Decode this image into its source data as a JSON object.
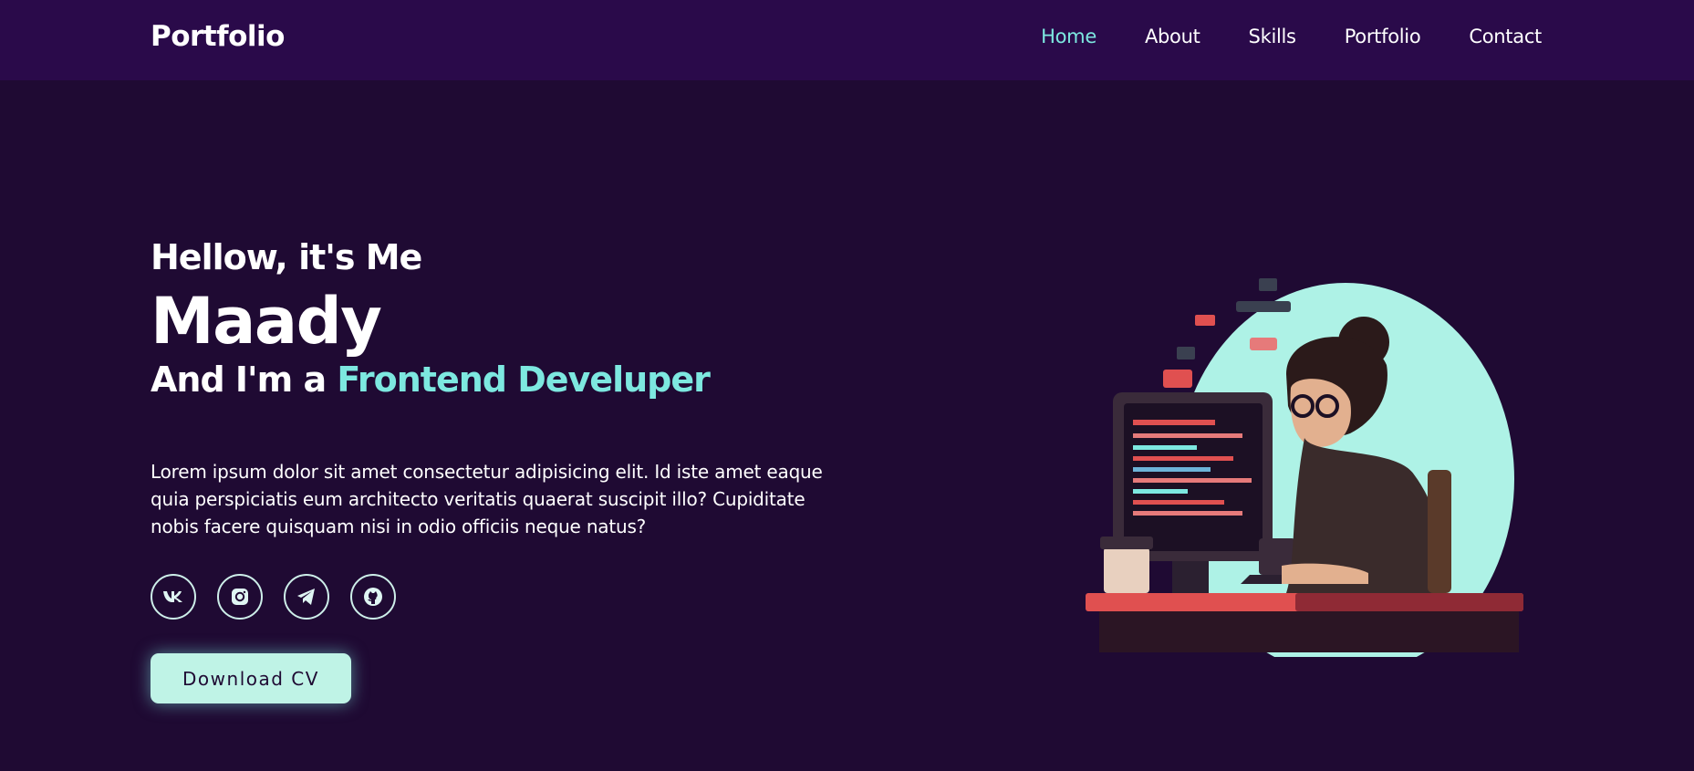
{
  "header": {
    "logo": "Portfolio",
    "nav": [
      "Home",
      "About",
      "Skills",
      "Portfolio",
      "Contact"
    ],
    "active_nav": "Home"
  },
  "hero": {
    "greeting": "Hellow, it's Me",
    "name": "Maady",
    "role_prefix": "And I'm a",
    "role_highlight": "Frontend Develuper",
    "description": "Lorem ipsum dolor sit amet consectetur adipisicing elit. Id iste amet eaque quia perspiciatis eum architecto veritatis quaerat suscipit illo? Cupiditate nobis facere quisquam nisi in odio officiis neque natus?",
    "socials": [
      {
        "name": "vk-icon",
        "glyph": "vk"
      },
      {
        "name": "instagram-icon",
        "glyph": "instagram"
      },
      {
        "name": "telegram-icon",
        "glyph": "telegram"
      },
      {
        "name": "github-icon",
        "glyph": "github"
      }
    ],
    "cv_button": "Download CV"
  },
  "colors": {
    "background": "#1f0a33",
    "header": "#2a0a4a",
    "accent": "#7de8e0",
    "button": "#bff3e6"
  }
}
